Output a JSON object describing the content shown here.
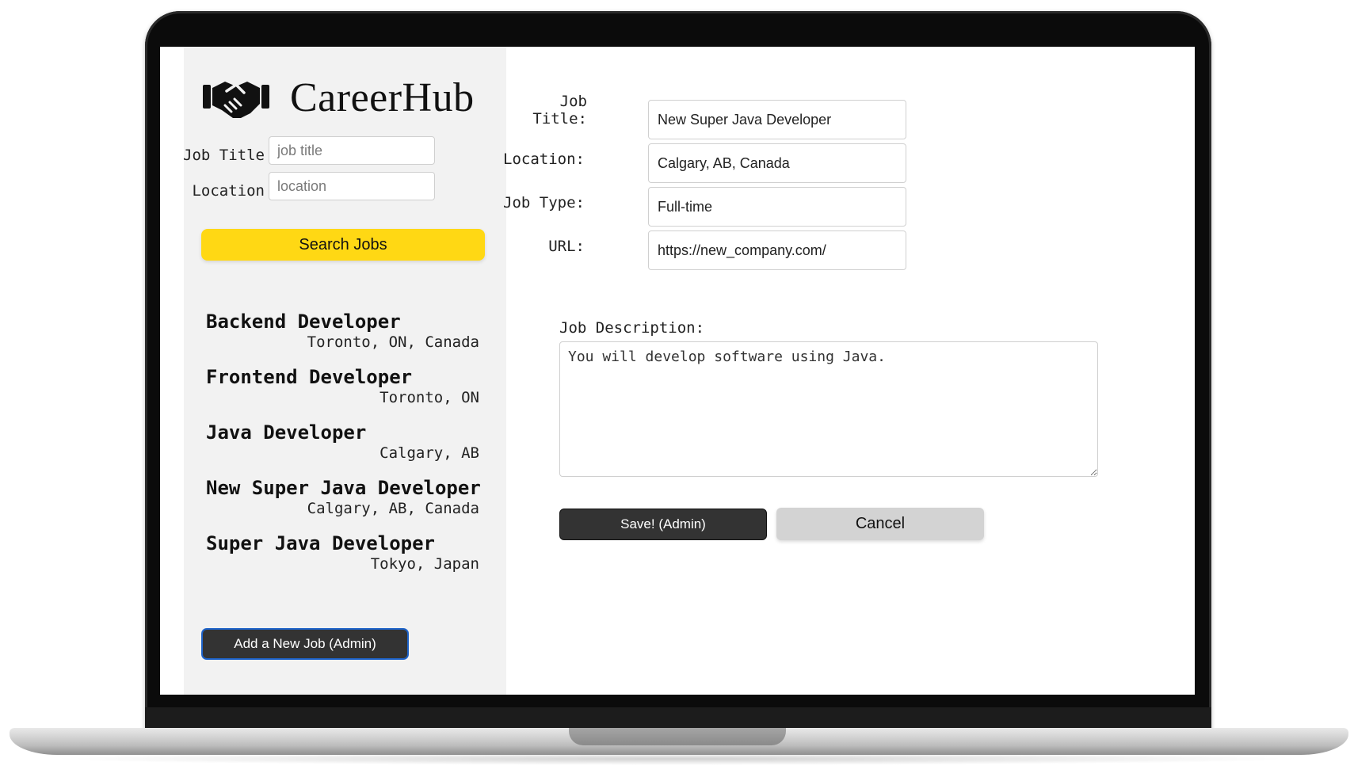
{
  "brand": {
    "name": "CareerHub",
    "logo_icon": "handshake-icon"
  },
  "search": {
    "job_title_label": "Job Title",
    "job_title_placeholder": "job title",
    "location_label": "Location",
    "location_placeholder": "location",
    "button_label": "Search Jobs"
  },
  "jobs": [
    {
      "title": "Backend Developer",
      "location": "Toronto, ON, Canada"
    },
    {
      "title": "Frontend Developer",
      "location": "Toronto, ON"
    },
    {
      "title": "Java Developer",
      "location": "Calgary, AB"
    },
    {
      "title": "New Super Java Developer",
      "location": "Calgary, AB, Canada"
    },
    {
      "title": "Super Java Developer",
      "location": "Tokyo, Japan"
    }
  ],
  "sidebar": {
    "add_job_label": "Add a New Job (Admin)"
  },
  "form": {
    "job_title_label_line1": "Job",
    "job_title_label_line2": "Title:",
    "job_title_value": "New Super Java Developer",
    "location_label": "Location:",
    "location_value": "Calgary, AB, Canada",
    "job_type_label": "Job Type:",
    "job_type_value": "Full-time",
    "url_label": "URL:",
    "url_value": "https://new_company.com/",
    "description_label": "Job Description:",
    "description_value": "You will develop software using Java.",
    "save_label": "Save! (Admin)",
    "cancel_label": "Cancel"
  },
  "colors": {
    "search_button": "#ffd814",
    "dark_button": "#333333",
    "cancel_button": "#d3d3d3",
    "sidebar_bg": "#f2f2f2",
    "focus_border": "#1e63c9"
  }
}
